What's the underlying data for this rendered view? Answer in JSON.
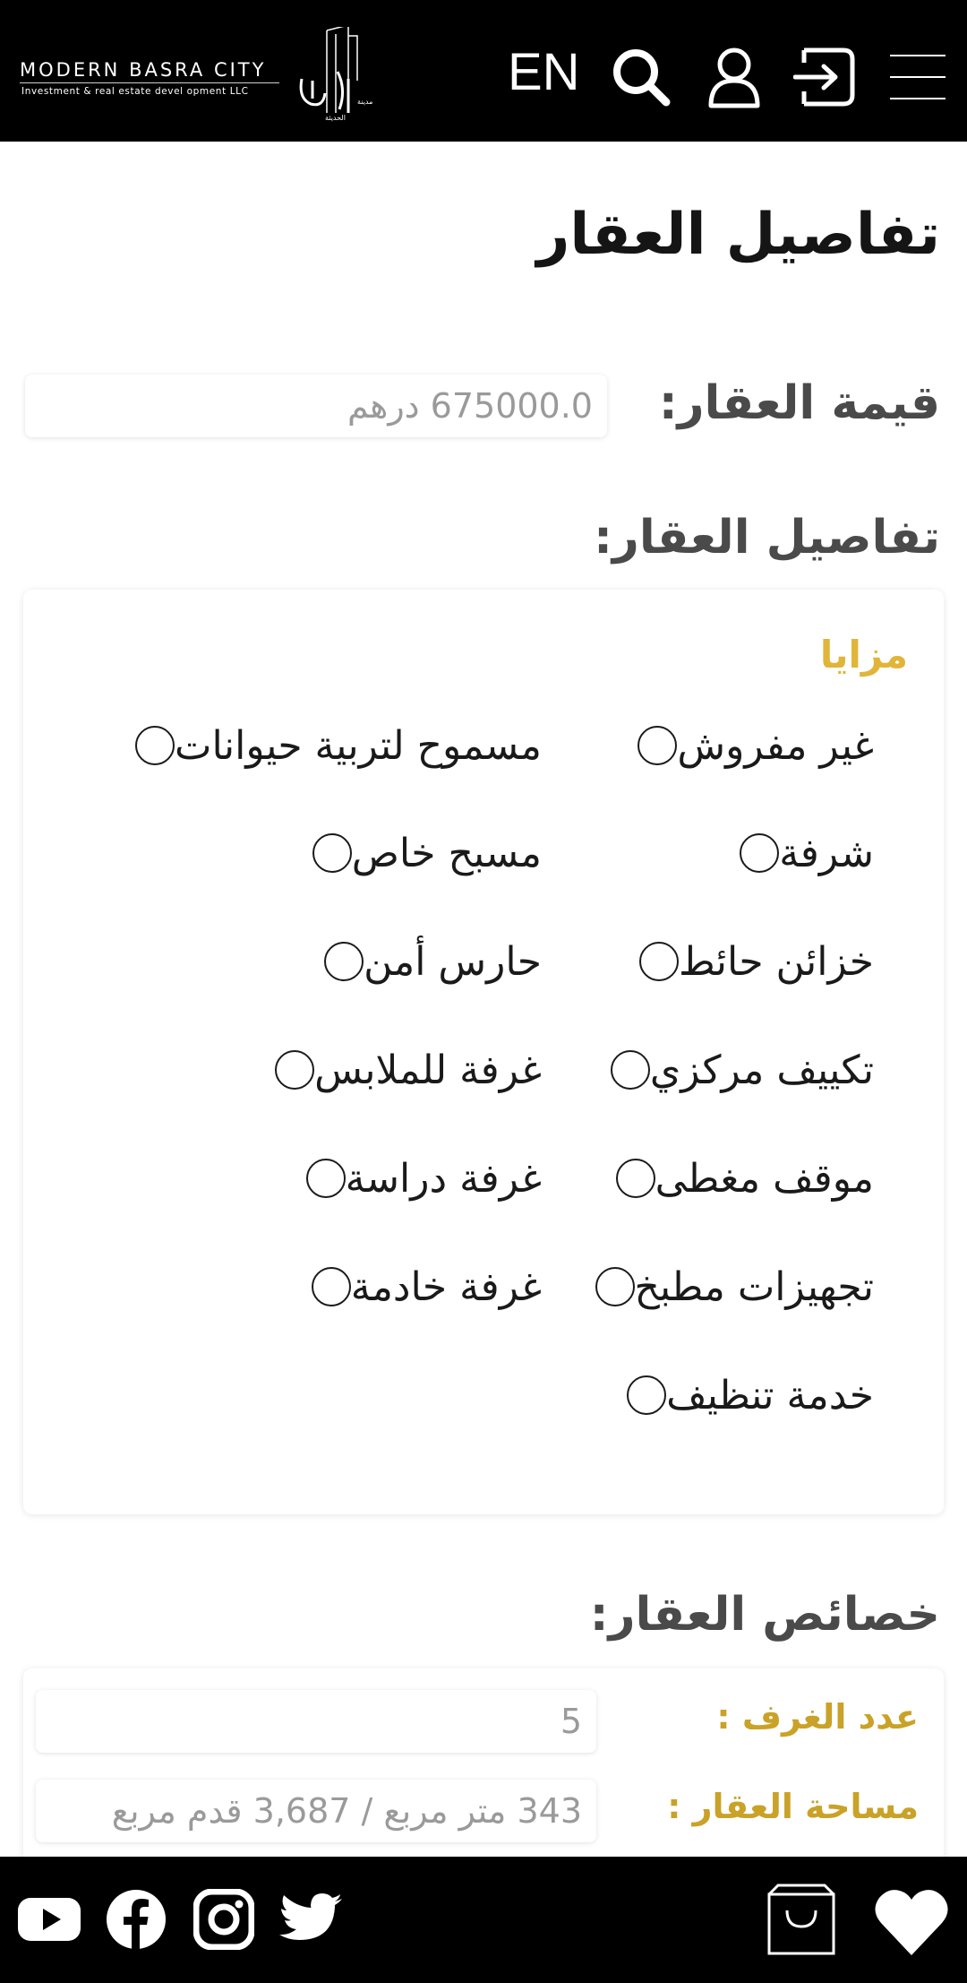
{
  "header": {
    "brand_name": "MODERN BASRA CITY",
    "brand_tagline": "Investment & real estate devel opment LLC",
    "language_label": "EN",
    "icons": [
      "search-icon",
      "user-icon",
      "login-icon",
      "menu-icon"
    ]
  },
  "page": {
    "title": "تفاصيل العقار"
  },
  "price": {
    "label": "قيمة العقار:",
    "value": "675000.0 درهم"
  },
  "details": {
    "label": "تفاصيل العقار:",
    "features_heading": "مزايا",
    "features": [
      "غير مفروش",
      "مسموح لتربية حيوانات",
      "شرفة",
      "مسبح خاص",
      "خزائن حائط",
      "حارس أمن",
      "تكييف مركزي",
      "غرفة للملابس",
      "موقف مغطى",
      "غرفة دراسة",
      "تجهيزات مطبخ",
      "غرفة خادمة",
      "خدمة تنظيف"
    ]
  },
  "properties": {
    "label": "خصائص العقار:",
    "rooms_label": "عدد الغرف :",
    "rooms_value": "5",
    "area_label": "مساحة العقار :",
    "area_value": "343 متر مربع /  3,687 قدم مربع"
  },
  "footer": {
    "icons": [
      "youtube-icon",
      "facebook-icon",
      "instagram-icon",
      "twitter-icon",
      "shopping-bag-icon",
      "heart-icon"
    ]
  },
  "colors": {
    "header_bg": "#000000",
    "accent_gold": "#e0b53a",
    "label_gold": "#c9a227"
  }
}
